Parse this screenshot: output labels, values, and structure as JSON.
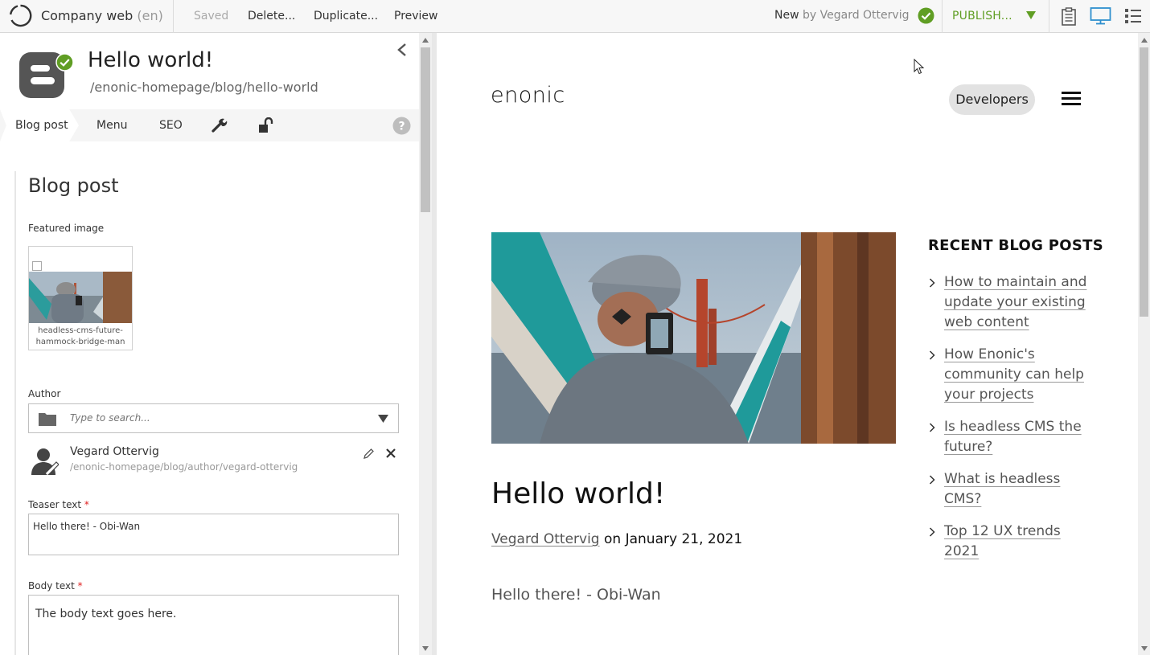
{
  "toolbar": {
    "project_name": "Company web",
    "project_lang": "(en)",
    "saved_label": "Saved",
    "delete_label": "Delete...",
    "duplicate_label": "Duplicate...",
    "preview_label": "Preview",
    "status_label": "New",
    "status_author": "by Vegard Ottervig",
    "publish_label": "PUBLISH...",
    "accent_color": "#609e24"
  },
  "content": {
    "display_name": "Hello world!",
    "path": "/enonic-homepage/blog/hello-world"
  },
  "tabs": [
    {
      "label": "Blog post",
      "active": true
    },
    {
      "label": "Menu"
    },
    {
      "label": "SEO"
    }
  ],
  "form": {
    "section_title": "Blog post",
    "featured_image_label": "Featured image",
    "featured_image_caption": "headless-cms-future-hammock-bridge-man",
    "author_label": "Author",
    "author_search_placeholder": "Type to search...",
    "author_name": "Vegard Ottervig",
    "author_path": "/enonic-homepage/blog/author/vegard-ottervig",
    "teaser_label": "Teaser text",
    "teaser_value": "Hello there! - Obi-Wan",
    "body_label": "Body text",
    "body_value": "The body text goes here.",
    "required_mark": "*"
  },
  "preview": {
    "logo_text": "enonic",
    "developers_label": "Developers",
    "post_title": "Hello world!",
    "post_author": "Vegard Ottervig",
    "post_date_text": "on January 21, 2021",
    "post_teaser": "Hello there! - Obi-Wan",
    "sidebar_title": "RECENT BLOG POSTS",
    "recent_posts": [
      "How to maintain and update your existing web content",
      "How Enonic's community can help your projects",
      "Is headless CMS the future?",
      "What is headless CMS?",
      "Top 12 UX trends 2021"
    ]
  }
}
